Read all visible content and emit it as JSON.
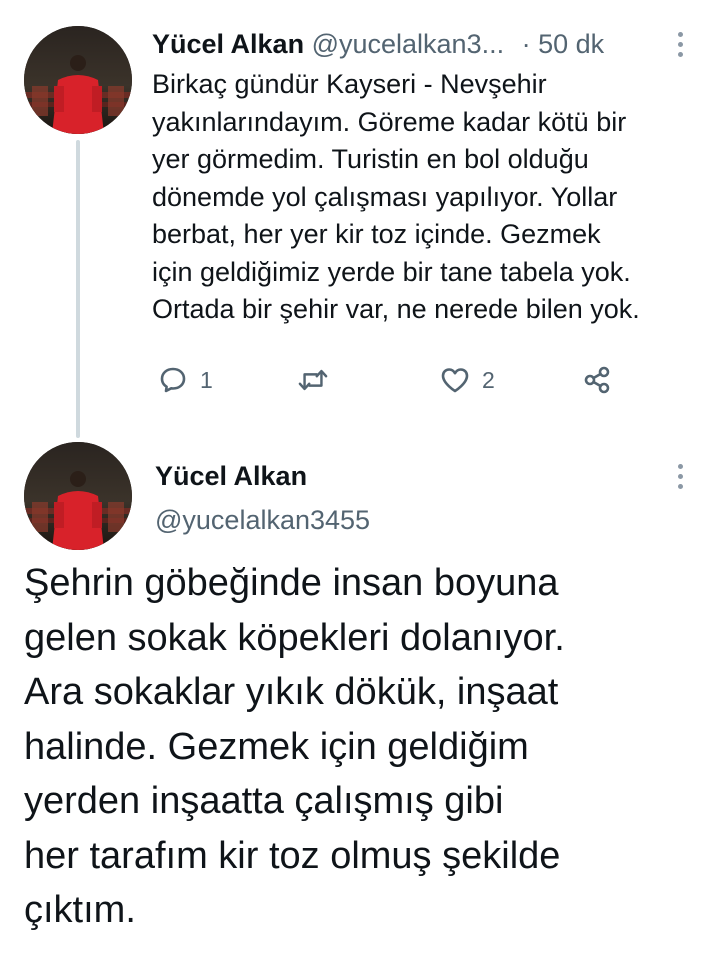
{
  "reply_tweet": {
    "author_name": "Yücel Alkan",
    "author_handle": "@yucelalkan3...",
    "separator": "·",
    "time": "50 dk",
    "text_lines": [
      "Birkaç gündür Kayseri - Nevşehir",
      "yakınlarındayım. Göreme kadar kötü bir",
      "yer görmedim. Turistin en bol olduğu",
      "dönemde yol çalışması yapılıyor. Yollar",
      "berbat, her yer kir toz içinde. Gezmek",
      "için geldiğimiz yerde bir tane tabela yok.",
      "Ortada bir şehir var, ne nerede bilen yok."
    ],
    "actions": {
      "reply_count": "1",
      "retweet_count": "",
      "like_count": "2"
    }
  },
  "main_tweet": {
    "author_name": "Yücel Alkan",
    "author_handle": "@yucelalkan3455",
    "text_lines": [
      "Şehrin göbeğinde insan boyuna",
      "gelen sokak köpekleri dolanıyor.",
      "Ara sokaklar yıkık dökük, inşaat",
      "halinde. Gezmek için geldiğim",
      "yerden inşaatta çalışmış gibi",
      "her tarafım kir toz olmuş şekilde",
      "çıktım."
    ]
  },
  "icons": {
    "more": "more-vertical-icon",
    "reply": "reply-icon",
    "retweet": "retweet-icon",
    "like": "like-icon",
    "share": "share-icon"
  },
  "colors": {
    "text_primary": "#0f1419",
    "text_secondary": "#536471",
    "thread_line": "#cfd9de",
    "avatar_shirt": "#d8222a"
  }
}
